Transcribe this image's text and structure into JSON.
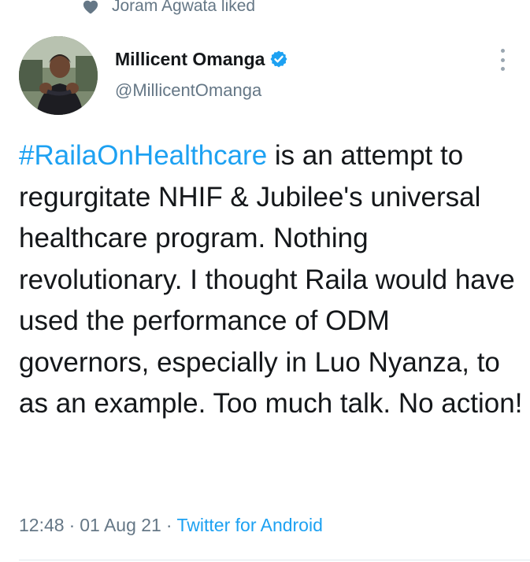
{
  "social_context": {
    "icon": "heart-icon",
    "text": "Joram Agwata liked"
  },
  "author": {
    "display_name": "Millicent Omanga",
    "handle": "@MillicentOmanga",
    "verified": true,
    "verified_color": "#1da1f2"
  },
  "tweet": {
    "hashtag": "#RailaOnHealthcare",
    "body": " is an attempt to regurgitate NHIF & Jubilee's universal healthcare program. Nothing revolutionary. I thought Raila would have used the performance of ODM governors, especially in Luo Nyanza, to as an example. Too much talk. No action!"
  },
  "meta": {
    "time": "12:48",
    "separator": "·",
    "date": "01 Aug 21",
    "source": "Twitter for Android"
  },
  "colors": {
    "link": "#1da1f2",
    "secondary_text": "#657786",
    "primary_text": "#14171a"
  }
}
